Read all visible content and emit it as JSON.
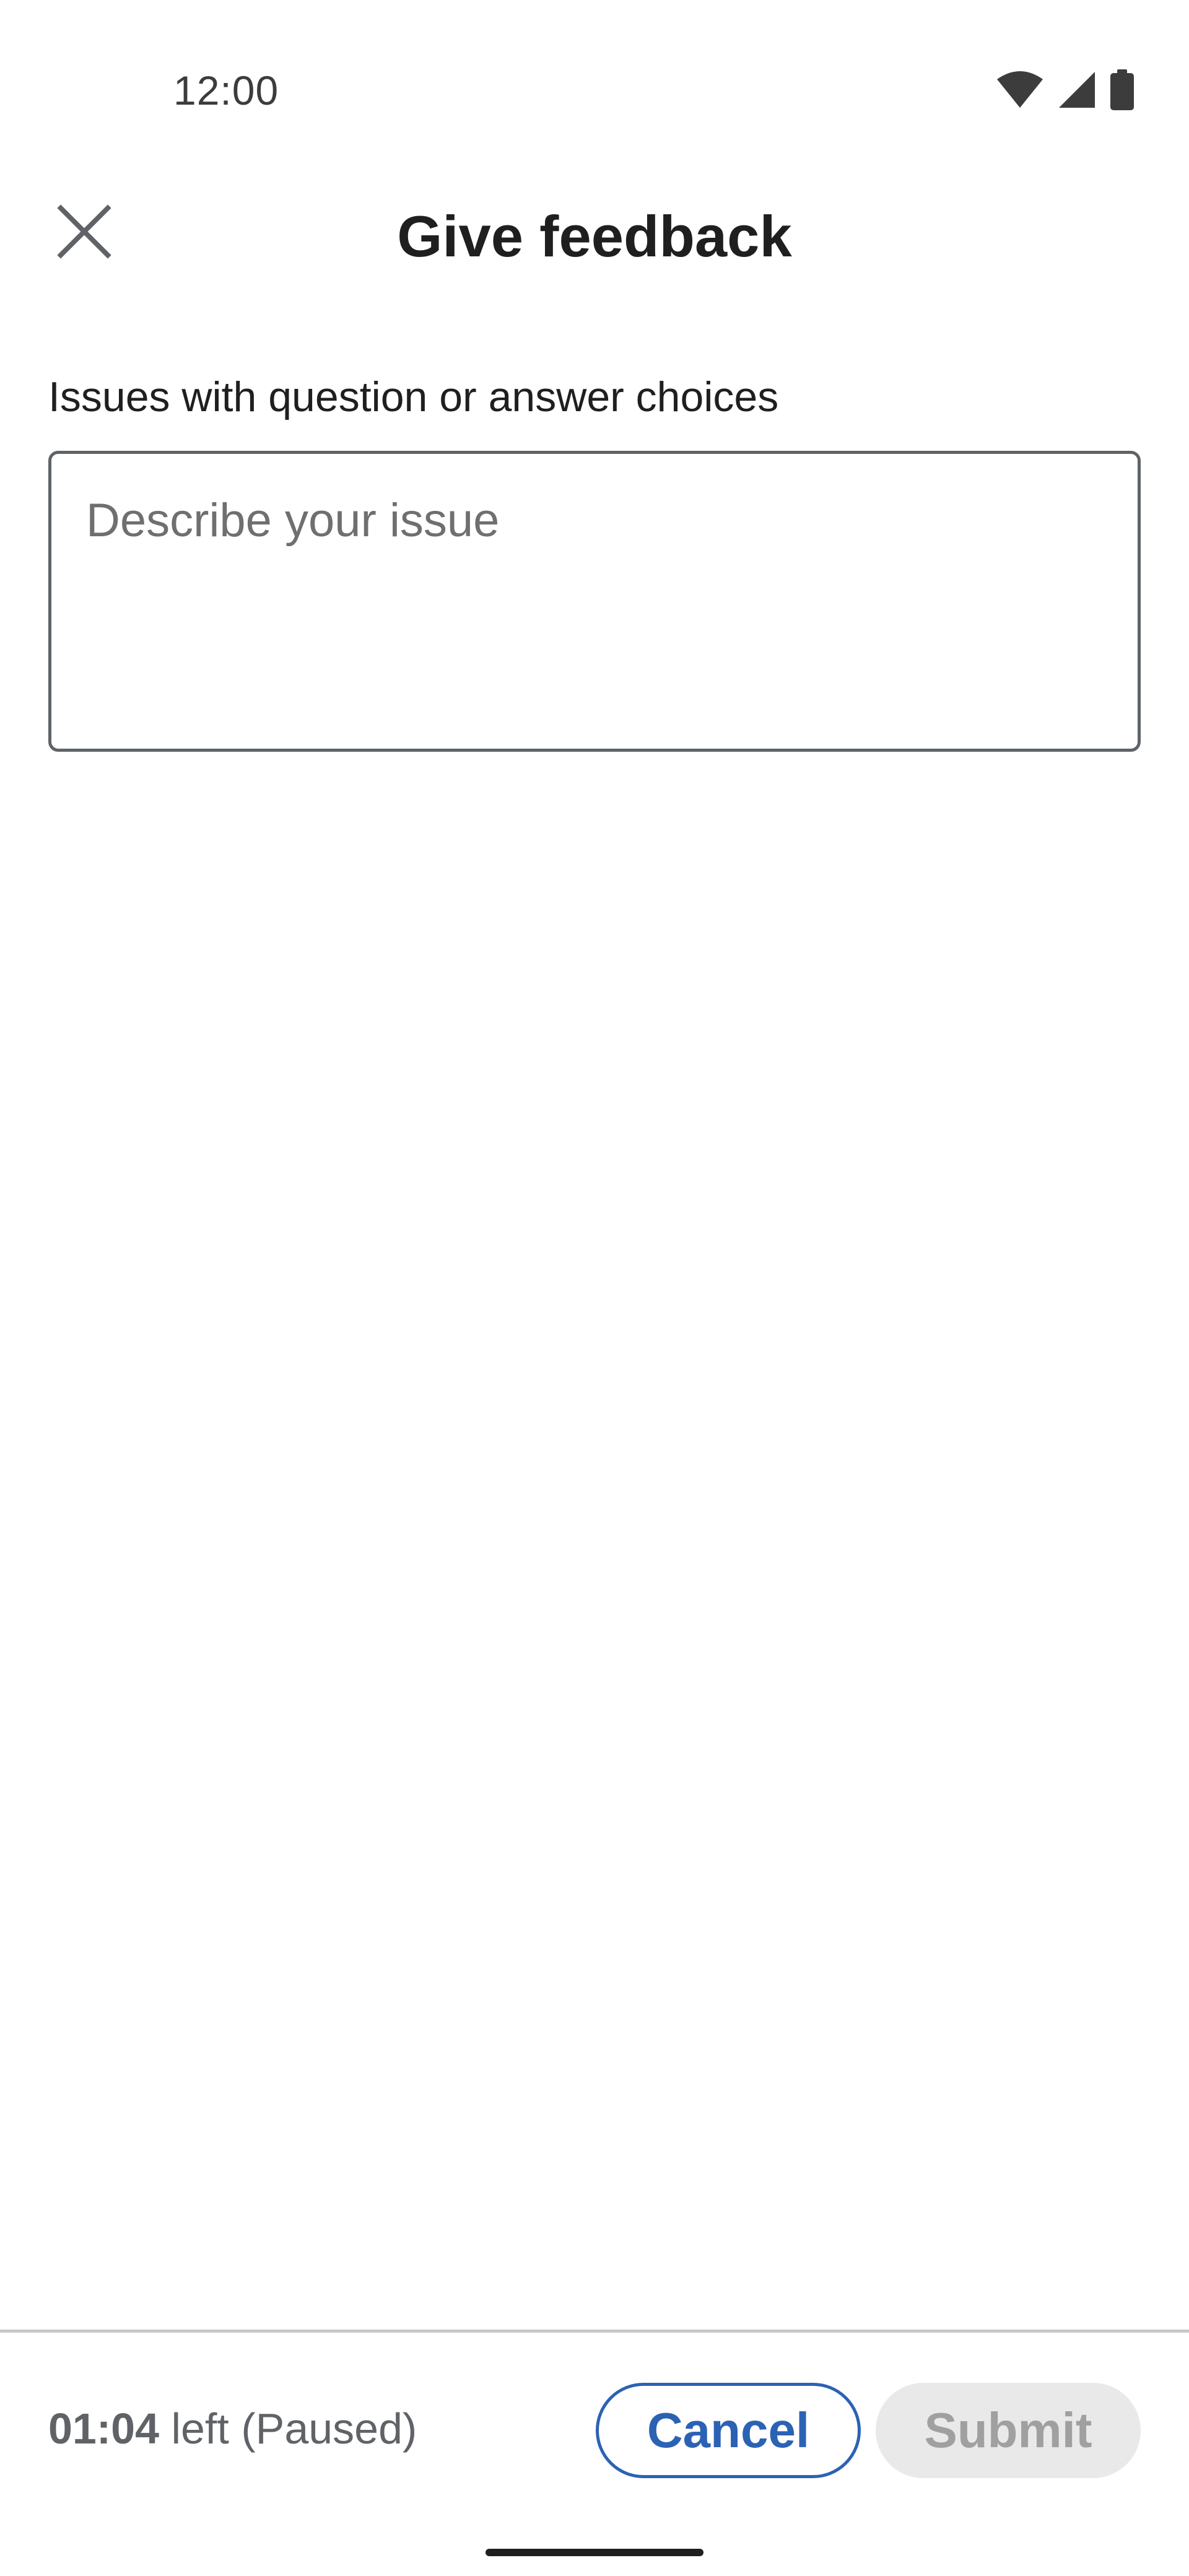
{
  "status_bar": {
    "time": "12:00",
    "icons": [
      "wifi-icon",
      "signal-icon",
      "battery-icon"
    ]
  },
  "app_bar": {
    "close_icon": "close-icon",
    "title": "Give feedback"
  },
  "form": {
    "label": "Issues with question or answer choices",
    "placeholder": "Describe your issue",
    "value": ""
  },
  "footer": {
    "timer_value": "01:04",
    "timer_suffix": " left (Paused)",
    "cancel_label": "Cancel",
    "submit_label": "Submit"
  },
  "colors": {
    "accent": "#2b62b4",
    "disabled_bg": "#e9e9e9",
    "disabled_text": "#a0a0a0"
  }
}
